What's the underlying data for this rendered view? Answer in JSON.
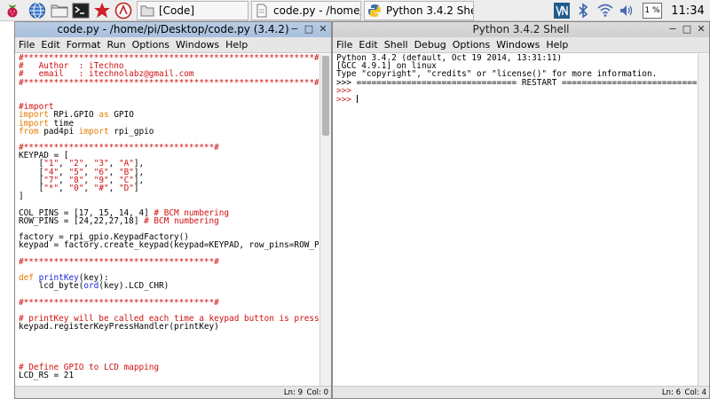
{
  "taskbar": {
    "tasks": [
      {
        "label": "[Code]"
      },
      {
        "label": "code.py - /home/pi/..."
      },
      {
        "label": "Python 3.4.2 Shell"
      }
    ],
    "cpu": "1 %",
    "clock": "11:34"
  },
  "editor": {
    "title": "code.py - /home/pi/Desktop/code.py (3.4.2)",
    "menus": [
      "File",
      "Edit",
      "Format",
      "Run",
      "Options",
      "Windows",
      "Help"
    ],
    "code": [
      {
        "text": "#**********************************************************#",
        "cls": "c-com"
      },
      {
        "text": "#   Author  : iTechno",
        "cls": "c-com"
      },
      {
        "text": "#   email   : itechnolabz@gmail.com",
        "cls": "c-com"
      },
      {
        "text": "#**********************************************************#",
        "cls": "c-com"
      },
      {
        "text": "",
        "cls": ""
      },
      {
        "text": "",
        "cls": ""
      },
      {
        "text": "#import",
        "cls": "c-com"
      },
      {
        "parts": [
          {
            "t": "import",
            "c": "c-kw"
          },
          {
            "t": " RPi.GPIO ",
            "c": ""
          },
          {
            "t": "as",
            "c": "c-kw"
          },
          {
            "t": " GPIO",
            "c": ""
          }
        ]
      },
      {
        "parts": [
          {
            "t": "import",
            "c": "c-kw"
          },
          {
            "t": " time",
            "c": ""
          }
        ]
      },
      {
        "parts": [
          {
            "t": "from",
            "c": "c-kw"
          },
          {
            "t": " pad4pi ",
            "c": ""
          },
          {
            "t": "import",
            "c": "c-kw"
          },
          {
            "t": " rpi_gpio",
            "c": ""
          }
        ]
      },
      {
        "text": "",
        "cls": ""
      },
      {
        "text": "#**************************************#",
        "cls": "c-com"
      },
      {
        "text": "KEYPAD = [",
        "cls": ""
      },
      {
        "parts": [
          {
            "t": "    [",
            "c": ""
          },
          {
            "t": "\"1\"",
            "c": "c-com"
          },
          {
            "t": ", ",
            "c": ""
          },
          {
            "t": "\"2\"",
            "c": "c-com"
          },
          {
            "t": ", ",
            "c": ""
          },
          {
            "t": "\"3\"",
            "c": "c-com"
          },
          {
            "t": ", ",
            "c": ""
          },
          {
            "t": "\"A\"",
            "c": "c-com"
          },
          {
            "t": "],",
            "c": ""
          }
        ]
      },
      {
        "parts": [
          {
            "t": "    [",
            "c": ""
          },
          {
            "t": "\"4\"",
            "c": "c-com"
          },
          {
            "t": ", ",
            "c": ""
          },
          {
            "t": "\"5\"",
            "c": "c-com"
          },
          {
            "t": ", ",
            "c": ""
          },
          {
            "t": "\"6\"",
            "c": "c-com"
          },
          {
            "t": ", ",
            "c": ""
          },
          {
            "t": "\"B\"",
            "c": "c-com"
          },
          {
            "t": "],",
            "c": ""
          }
        ]
      },
      {
        "parts": [
          {
            "t": "    [",
            "c": ""
          },
          {
            "t": "\"7\"",
            "c": "c-com"
          },
          {
            "t": ", ",
            "c": ""
          },
          {
            "t": "\"8\"",
            "c": "c-com"
          },
          {
            "t": ", ",
            "c": ""
          },
          {
            "t": "\"9\"",
            "c": "c-com"
          },
          {
            "t": ", ",
            "c": ""
          },
          {
            "t": "\"C\"",
            "c": "c-com"
          },
          {
            "t": "],",
            "c": ""
          }
        ]
      },
      {
        "parts": [
          {
            "t": "    [",
            "c": ""
          },
          {
            "t": "\"*\"",
            "c": "c-com"
          },
          {
            "t": ", ",
            "c": ""
          },
          {
            "t": "\"0\"",
            "c": "c-com"
          },
          {
            "t": ", ",
            "c": ""
          },
          {
            "t": "\"#\"",
            "c": "c-com"
          },
          {
            "t": ", ",
            "c": ""
          },
          {
            "t": "\"D\"",
            "c": "c-com"
          },
          {
            "t": "]",
            "c": ""
          }
        ]
      },
      {
        "text": "]",
        "cls": ""
      },
      {
        "text": "",
        "cls": ""
      },
      {
        "parts": [
          {
            "t": "COL_PINS = [17, 15, 14, 4] ",
            "c": ""
          },
          {
            "t": "# BCM numbering",
            "c": "c-com"
          }
        ]
      },
      {
        "parts": [
          {
            "t": "ROW_PINS = [24,22,27,18] ",
            "c": ""
          },
          {
            "t": "# BCM numbering",
            "c": "c-com"
          }
        ]
      },
      {
        "text": "",
        "cls": ""
      },
      {
        "text": "factory = rpi_gpio.KeypadFactory()",
        "cls": ""
      },
      {
        "text": "keypad = factory.create_keypad(keypad=KEYPAD, row_pins=ROW_PINS, co",
        "cls": ""
      },
      {
        "text": "",
        "cls": ""
      },
      {
        "text": "#**************************************#",
        "cls": "c-com"
      },
      {
        "text": "",
        "cls": ""
      },
      {
        "parts": [
          {
            "t": "def",
            "c": "c-kw"
          },
          {
            "t": " ",
            "c": ""
          },
          {
            "t": "printKey",
            "c": "c-def"
          },
          {
            "t": "(key):",
            "c": ""
          }
        ]
      },
      {
        "parts": [
          {
            "t": "    lcd_byte(",
            "c": ""
          },
          {
            "t": "ord",
            "c": "c-def"
          },
          {
            "t": "(key).LCD_CHR)",
            "c": ""
          }
        ]
      },
      {
        "text": "",
        "cls": ""
      },
      {
        "text": "#**************************************#",
        "cls": "c-com"
      },
      {
        "text": "",
        "cls": ""
      },
      {
        "text": "# printKey will be called each time a keypad button is pressed",
        "cls": "c-com"
      },
      {
        "text": "keypad.registerKeyPressHandler(printKey)",
        "cls": ""
      },
      {
        "text": "",
        "cls": ""
      },
      {
        "text": "",
        "cls": ""
      },
      {
        "text": "",
        "cls": ""
      },
      {
        "text": "",
        "cls": ""
      },
      {
        "text": "# Define GPIO to LCD mapping",
        "cls": "c-com"
      },
      {
        "text": "LCD_RS = 21",
        "cls": ""
      }
    ],
    "status": {
      "ln": "Ln: 9",
      "col": "Col: 0"
    }
  },
  "shell": {
    "title": "Python 3.4.2 Shell",
    "menus": [
      "File",
      "Edit",
      "Shell",
      "Debug",
      "Options",
      "Windows",
      "Help"
    ],
    "lines": [
      {
        "text": "Python 3.4.2 (default, Oct 19 2014, 13:31:11)",
        "cls": ""
      },
      {
        "text": "[GCC 4.9.1] on linux",
        "cls": ""
      },
      {
        "text": "Type \"copyright\", \"credits\" or \"license()\" for more information.",
        "cls": ""
      },
      {
        "text": ">>> ================================ RESTART ================================",
        "cls": ""
      },
      {
        "text": ">>>",
        "cls": "c-prompt"
      },
      {
        "text": ">>>",
        "cls": "c-prompt"
      }
    ],
    "status": {
      "ln": "Ln: 6",
      "col": "Col: 4"
    }
  },
  "colors": {
    "accent": "#a7bfdd",
    "comment": "#d01010",
    "keyword": "#e87b00",
    "builtin": "#1a28d8"
  }
}
